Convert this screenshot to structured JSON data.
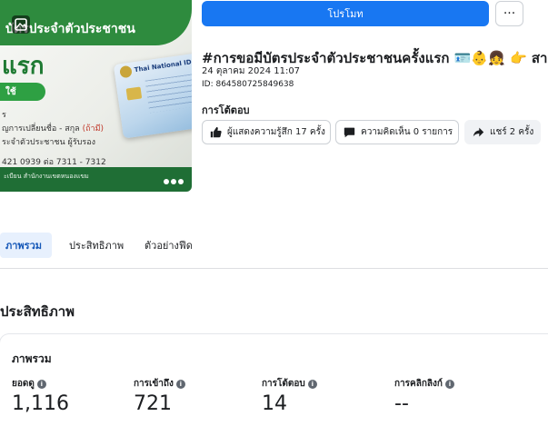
{
  "thumbnail": {
    "top_band_text": "บัตรประจำตัวประชาชน",
    "big_text": "แรก",
    "pill_text": "ใช้",
    "lines": [
      "ร",
      "ญการเปลี่ยนชื่อ - สกุล",
      "ระจำตัวประชาชน ผู้รับรอง"
    ],
    "line_red_suffix": "(ถ้ามี)",
    "phone": "421 0939 ต่อ 7311 - 7312",
    "bottom_text": "ะเบียน สำนักงานเขตหนองแขม",
    "card_title": "Thai National ID Ca"
  },
  "header": {
    "promote_label": "โปรโมท",
    "more_label": "···"
  },
  "post": {
    "title": "#การขอมีบัตรประจำตัวประชาชนครั้งแรก 🪪👶👧 👉 สามา...",
    "date": "24 ตุลาคม 2024 11:07",
    "id": "ID: 864580725849638"
  },
  "reactions": {
    "label": "การโต้ตอบ",
    "likes": "ผู้แสดงความรู้สึก 17 ครั้ง",
    "comments": "ความคิดเห็น 0 รายการ",
    "shares": "แชร์ 2 ครั้ง"
  },
  "tabs": {
    "overview": "ภาพรวม",
    "performance": "ประสิทธิภาพ",
    "preview": "ตัวอย่างฟีด"
  },
  "performance": {
    "section_title": "ประสิทธิภาพ",
    "card_title": "ภาพรวม",
    "metrics": [
      {
        "label": "ยอดดู",
        "value": "1,116"
      },
      {
        "label": "การเข้าถึง",
        "value": "721"
      },
      {
        "label": "การโต้ตอบ",
        "value": "14"
      },
      {
        "label": "การคลิกลิงก์",
        "value": "--"
      }
    ]
  },
  "colors": {
    "accent": "#1877f2",
    "tab_active_bg": "#e7f0fd",
    "thumbnail_green": "#2e8b3e"
  }
}
